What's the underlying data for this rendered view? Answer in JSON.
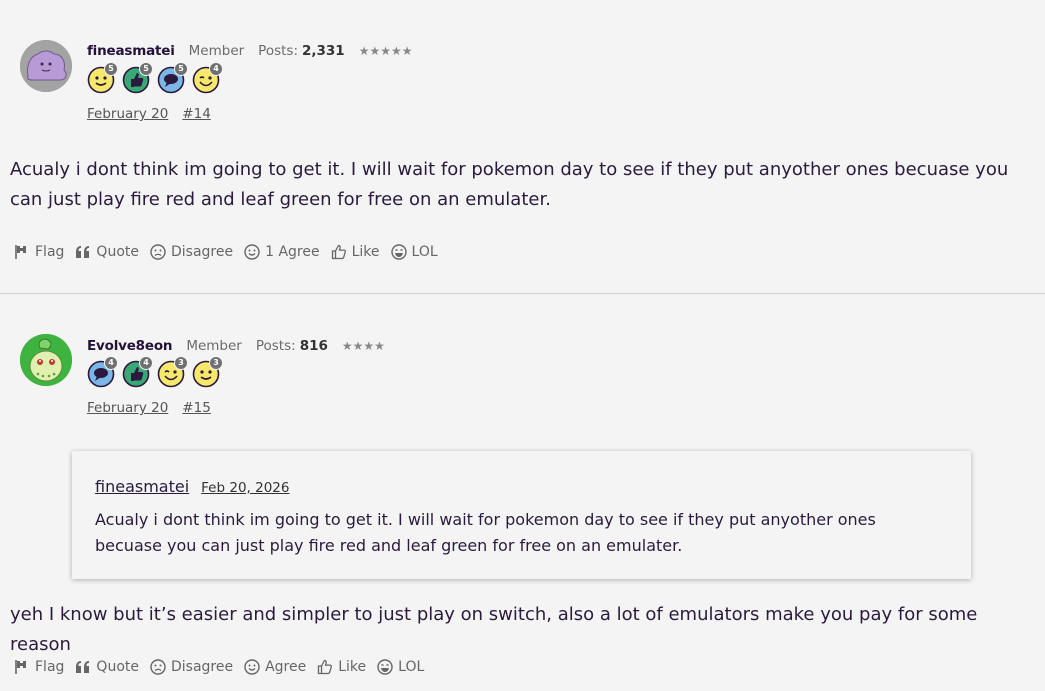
{
  "posts": [
    {
      "username": "fineasmatei",
      "role": "Member",
      "posts_label": "Posts:",
      "posts_count": "2,331",
      "stars": "★★★★★",
      "badges": [
        {
          "icon": "smile-face-badge-icon",
          "count": "5",
          "color": "#f5e86a"
        },
        {
          "icon": "thumbs-up-badge-icon",
          "count": "5",
          "color": "#3aa876"
        },
        {
          "icon": "speech-bubble-badge-icon",
          "count": "5",
          "color": "#7ab6e6"
        },
        {
          "icon": "wink-face-badge-icon",
          "count": "4",
          "color": "#f5e86a"
        }
      ],
      "date": "February 20",
      "post_number": "#14",
      "body": "Acualy i dont think im going to get it. I will wait for pokemon day to see if they put anyother ones becuase you can just play fire red and leaf green for free on an emulater.",
      "actions": {
        "flag": "Flag",
        "quote": "Quote",
        "disagree": "Disagree",
        "agree": "1 Agree",
        "like": "Like",
        "lol": "LOL"
      }
    },
    {
      "username": "Evolve8eon",
      "role": "Member",
      "posts_label": "Posts:",
      "posts_count": "816",
      "stars": "★★★★",
      "badges": [
        {
          "icon": "speech-bubble-badge-icon",
          "count": "4",
          "color": "#7ab6e6"
        },
        {
          "icon": "thumbs-up-badge-icon",
          "count": "4",
          "color": "#3aa876"
        },
        {
          "icon": "wink-face-badge-icon",
          "count": "3",
          "color": "#f5e86a"
        },
        {
          "icon": "smile-face-badge-icon",
          "count": "3",
          "color": "#f5e86a"
        }
      ],
      "date": "February 20",
      "post_number": "#15",
      "quote": {
        "author": "fineasmatei",
        "date": "Feb 20, 2026",
        "text": "Acualy i dont think im going to get it. I will wait for pokemon day to see if they put anyother ones becuase you can just play fire red and leaf green for free on an emulater."
      },
      "body": "yeh I know but it’s easier and simpler to just play on switch, also a lot of emulators make you pay for some reason",
      "actions": {
        "flag": "Flag",
        "quote": "Quote",
        "disagree": "Disagree",
        "agree": "Agree",
        "like": "Like",
        "lol": "LOL"
      }
    }
  ]
}
